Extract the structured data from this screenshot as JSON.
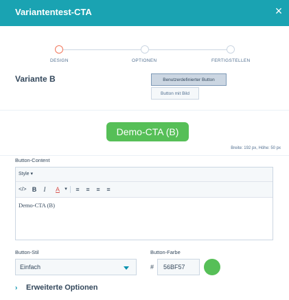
{
  "header": {
    "title": "Variantentest-CTA",
    "close_icon": "×"
  },
  "steps": [
    {
      "label": "DESIGN",
      "active": true
    },
    {
      "label": "OPTIONEN",
      "active": false
    },
    {
      "label": "FERTIGSTELLEN",
      "active": false
    }
  ],
  "variant": {
    "title": "Variante B",
    "options": [
      {
        "label": "Benutzerdefinierter Button",
        "selected": true
      },
      {
        "label": "Button mit Bild",
        "selected": false
      }
    ]
  },
  "preview": {
    "cta_label": "Demo-CTA (B)",
    "dimensions": "Breite: 192 px, Höhe: 50 px"
  },
  "content": {
    "label": "Button-Content",
    "style_dropdown": "Style ▾",
    "toolbar": {
      "source": "</>",
      "bold": "B",
      "italic": "I",
      "text_color": "A",
      "text_color_caret": "▾",
      "align_left": "≡",
      "align_center": "≡",
      "align_right": "≡",
      "justify": "≡"
    },
    "editor_text": "Demo-CTA (B)"
  },
  "style": {
    "label": "Button-Stil",
    "value": "Einfach"
  },
  "color": {
    "label": "Button-Farbe",
    "hash": "#",
    "value": "56BF57",
    "swatch": "#56bf57"
  },
  "advanced": {
    "chevron": "›",
    "label": "Erweiterte Optionen"
  },
  "colors": {
    "header": "#1aa3b2",
    "cta": "#56bf57",
    "active_step": "#f2765a",
    "accent": "#0091ae"
  }
}
